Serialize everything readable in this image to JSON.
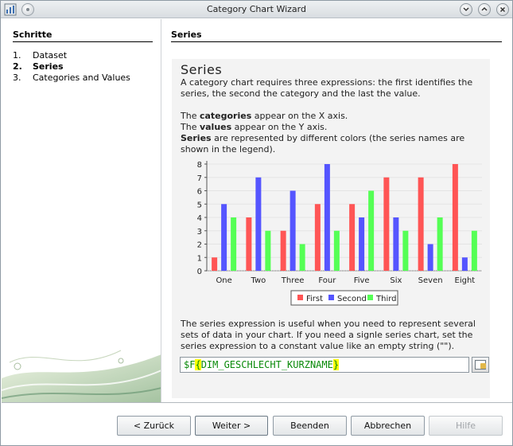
{
  "window": {
    "title": "Category Chart Wizard"
  },
  "steps": {
    "header": "Schritte",
    "items": [
      {
        "num": "1.",
        "label": "Dataset",
        "active": false
      },
      {
        "num": "2.",
        "label": "Series",
        "active": true
      },
      {
        "num": "3.",
        "label": "Categories and Values",
        "active": false
      }
    ]
  },
  "content": {
    "section_header": "Series",
    "heading": "Series",
    "intro": "A category chart requires three expressions: the first identifies the series, the second the category and the last the value.",
    "categories_line": {
      "bold": "categories",
      "pre": "The ",
      "post": " appear on the X axis."
    },
    "values_line": {
      "bold": "values",
      "pre": "The ",
      "post": " appear on the Y axis."
    },
    "series_line": {
      "bold": "Series",
      "pre": "",
      "post": " are represented by different colors (the series names are shown in the legend)."
    },
    "explanation": "The series expression is useful when you need to represent several sets of data in your chart. If you need a signle series chart, set the series expression to a constant value like an empty string (\"\").",
    "expression": {
      "prefix": "$F",
      "open": "{",
      "field": "DIM_GESCHLECHT_KURZNAME",
      "close": "}"
    },
    "expression_button_icon": "expression-editor-icon"
  },
  "chart_data": {
    "type": "bar",
    "categories": [
      "One",
      "Two",
      "Three",
      "Four",
      "Five",
      "Six",
      "Seven",
      "Eight"
    ],
    "series": [
      {
        "name": "First",
        "color": "#ff5555",
        "values": [
          1,
          4,
          3,
          5,
          5,
          7,
          7,
          8
        ]
      },
      {
        "name": "Second",
        "color": "#5555ff",
        "values": [
          5,
          7,
          6,
          8,
          4,
          4,
          2,
          1
        ]
      },
      {
        "name": "Third",
        "color": "#55ff55",
        "values": [
          4,
          3,
          2,
          3,
          6,
          3,
          4,
          3
        ]
      }
    ],
    "ylim": [
      0,
      8
    ],
    "yticks": [
      0,
      1,
      2,
      3,
      4,
      5,
      6,
      7,
      8
    ],
    "xlabel": "",
    "ylabel": "",
    "legend": "bottom"
  },
  "buttons": {
    "back": "< Zurück",
    "next": "Weiter >",
    "finish": "Beenden",
    "cancel": "Abbrechen",
    "help": "Hilfe"
  }
}
